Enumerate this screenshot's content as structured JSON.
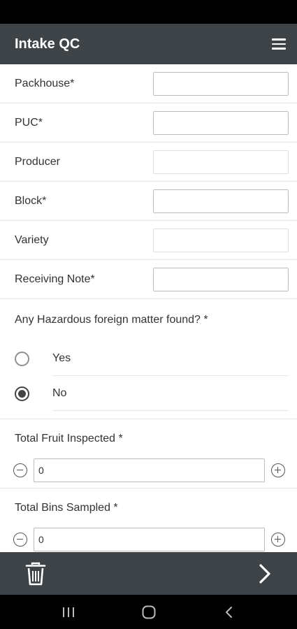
{
  "app": {
    "title": "Intake QC"
  },
  "fields": [
    {
      "label": "Packhouse*",
      "value": ""
    },
    {
      "label": "PUC*",
      "value": ""
    },
    {
      "label": "Producer",
      "value": ""
    },
    {
      "label": "Block*",
      "value": ""
    },
    {
      "label": "Variety",
      "value": ""
    },
    {
      "label": "Receiving Note*",
      "value": ""
    }
  ],
  "hazard": {
    "question": "Any Hazardous foreign matter found? *",
    "options": [
      {
        "label": "Yes",
        "selected": false
      },
      {
        "label": "No",
        "selected": true
      }
    ]
  },
  "steppers": [
    {
      "label": "Total Fruit Inspected *",
      "value": "0"
    },
    {
      "label": "Total Bins Sampled *",
      "value": "0"
    }
  ],
  "icons": {
    "menu": "hamburger-menu-icon",
    "delete": "trash-icon",
    "next": "chevron-right-icon",
    "decrement": "minus-circle-icon",
    "increment": "plus-circle-icon",
    "nav_recents": "recents-icon",
    "nav_home": "home-icon",
    "nav_back": "back-icon"
  },
  "colors": {
    "header": "#3d4347",
    "radio_selected": "#444444"
  }
}
